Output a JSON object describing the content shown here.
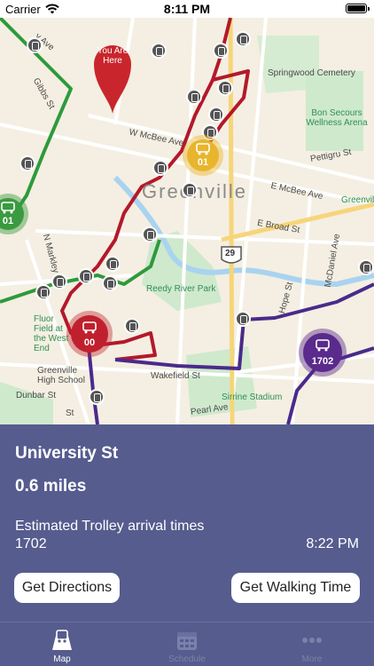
{
  "status_bar": {
    "carrier": "Carrier",
    "time": "8:11 PM"
  },
  "map": {
    "you_are_here": "You Are Here",
    "city_label": "Greenville",
    "labels": {
      "springwood": "Springwood Cemetery",
      "bon_secours": "Bon Secours Wellness Arena",
      "reedy_river": "Reedy River Park",
      "fluor_field": "Fluor Field at the West End",
      "greenville_high": "Greenville High School",
      "sirrine": "Sirrine Stadium",
      "w_mcbee": "W McBee Ave",
      "e_mcbee": "E McBee Ave",
      "e_broad": "E Broad St",
      "pettigru": "Pettigru St",
      "wakefield": "Wakefield St",
      "pearl": "Pearl Ave",
      "dunbar": "Dunbar St",
      "gibbs": "Gibbs St",
      "n_markley": "N Markley St",
      "hope": "Hope St",
      "mcdaniel": "McDaniel Ave",
      "greenville_edge": "Greenvill",
      "highway": "29",
      "y_ave": "y Ave",
      "dunbar_suffix": "St"
    },
    "trolleys": [
      {
        "number": "01",
        "color": "#e8b52c"
      },
      {
        "number": "00",
        "color": "#c0202e"
      },
      {
        "number": "1702",
        "color": "#5a2a8c"
      },
      {
        "number": "01",
        "color": "#3a9a40"
      }
    ],
    "route_colors": {
      "red": "#b4182b",
      "green": "#2d9a3c",
      "purple": "#4a2a8c"
    }
  },
  "info": {
    "stop_name": "University St",
    "distance": "0.6 miles",
    "arrival_label": "Estimated Trolley arrival times",
    "route": "1702",
    "arrival_time": "8:22 PM",
    "directions_button": "Get Directions",
    "walking_button": "Get Walking Time"
  },
  "tabs": [
    {
      "label": "Map",
      "icon": "map-trolley-icon",
      "active": true
    },
    {
      "label": "Schedule",
      "icon": "calendar-icon",
      "active": false
    },
    {
      "label": "More",
      "icon": "more-dots-icon",
      "active": false
    }
  ]
}
